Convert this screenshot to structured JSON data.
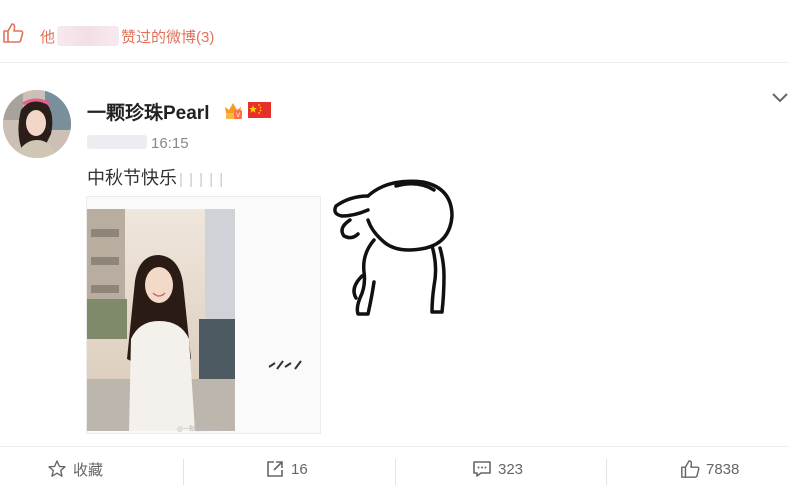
{
  "liked_header": {
    "prefix": "他",
    "suffix": "赞过的微博(3)"
  },
  "post": {
    "username": "一颗珍珠Pearl",
    "time": "16:15",
    "text": "中秋节快乐",
    "watermark": "@一颗珍珠Pearl",
    "colors": {
      "accent_link": "#e0735a",
      "flag_red": "#e8302a",
      "vip_orange": "#f39b23"
    }
  },
  "actions": {
    "favorite_label": "收藏",
    "repost_count": "16",
    "comment_count": "323",
    "like_count": "7838"
  },
  "icons": [
    "thumb-up-icon",
    "vip-badge-icon",
    "china-flag-icon",
    "chevron-down-icon",
    "star-icon",
    "repost-icon",
    "comment-icon"
  ]
}
